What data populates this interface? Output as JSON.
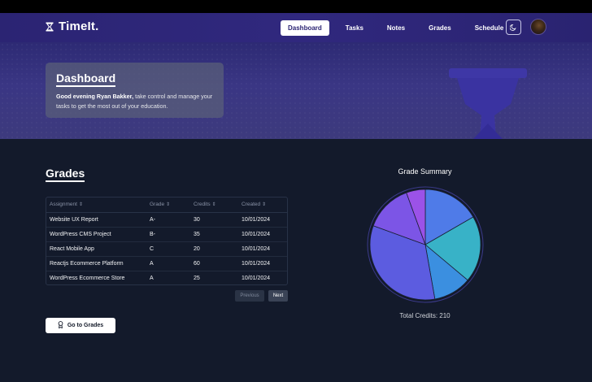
{
  "app": {
    "brand": "TimeIt."
  },
  "nav": {
    "items": [
      "Dashboard",
      "Tasks",
      "Notes",
      "Grades",
      "Schedule"
    ],
    "active": "Dashboard",
    "theme_icon": "moon-icon",
    "avatar_icon": "user-avatar"
  },
  "hero": {
    "title": "Dashboard",
    "greeting": "Good evening Ryan Bakker,",
    "message": " take control and manage your tasks to get the most out of your education."
  },
  "grades": {
    "title": "Grades",
    "columns": [
      "Assignment",
      "Grade",
      "Credits",
      "Created"
    ],
    "rows": [
      {
        "assignment": "Website UX Report",
        "grade": "A-",
        "credits": "30",
        "created": "10/01/2024"
      },
      {
        "assignment": "WordPress CMS Project",
        "grade": "B-",
        "credits": "35",
        "created": "10/01/2024"
      },
      {
        "assignment": "React Mobile App",
        "grade": "C",
        "credits": "20",
        "created": "10/01/2024"
      },
      {
        "assignment": "Reactjs Ecommerce Platform",
        "grade": "A",
        "credits": "60",
        "created": "10/01/2024"
      },
      {
        "assignment": "WordPress Ecommerce Store",
        "grade": "A",
        "credits": "25",
        "created": "10/01/2024"
      }
    ],
    "previous_label": "Previous",
    "next_label": "Next",
    "goto_label": "Go to Grades"
  },
  "chart_data": {
    "type": "pie",
    "title": "Grade Summary",
    "total_label": "Total Credits: 210",
    "slices": [
      {
        "label": "Website UX Report",
        "value": 30,
        "color": "#4f7be8"
      },
      {
        "label": "WordPress CMS Project",
        "value": 35,
        "color": "#38b2c7"
      },
      {
        "label": "React Mobile App",
        "value": 20,
        "color": "#3b8fe0"
      },
      {
        "label": "Reactjs Ecommerce Platform",
        "value": 60,
        "color": "#5c5ce0"
      },
      {
        "label": "WordPress Ecommerce Store",
        "value": 25,
        "color": "#7c55e6"
      },
      {
        "label": "",
        "value": 10,
        "color": "#9b52e8"
      }
    ],
    "legend": "none"
  },
  "colors": {
    "navbar": "#2b2473",
    "background": "#131a2b",
    "accent": "#5c5ce0"
  }
}
